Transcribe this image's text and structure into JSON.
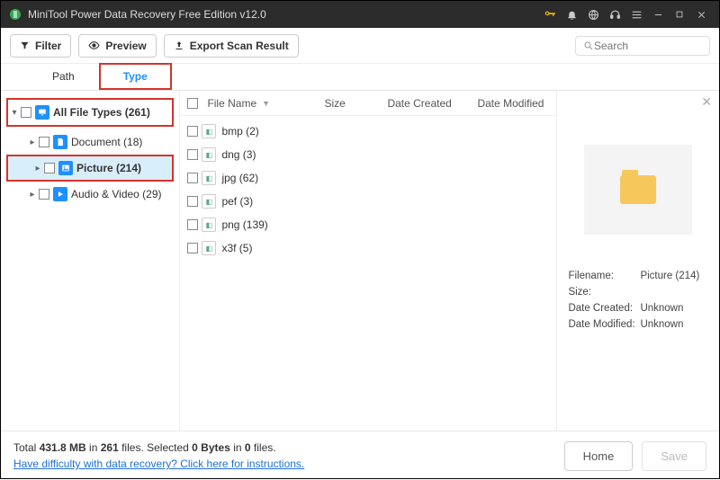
{
  "window": {
    "title": "MiniTool Power Data Recovery Free Edition v12.0"
  },
  "toolbar": {
    "filter": "Filter",
    "preview": "Preview",
    "export": "Export Scan Result",
    "search_placeholder": "Search"
  },
  "tabs": {
    "path": "Path",
    "type": "Type"
  },
  "tree": {
    "root": "All File Types (261)",
    "items": [
      {
        "label": "Document (18)"
      },
      {
        "label": "Picture (214)"
      },
      {
        "label": "Audio & Video (29)"
      }
    ]
  },
  "filelist": {
    "headers": {
      "name": "File Name",
      "size": "Size",
      "created": "Date Created",
      "modified": "Date Modified"
    },
    "rows": [
      {
        "name": "bmp (2)"
      },
      {
        "name": "dng (3)"
      },
      {
        "name": "jpg (62)"
      },
      {
        "name": "pef (3)"
      },
      {
        "name": "png (139)"
      },
      {
        "name": "x3f (5)"
      }
    ]
  },
  "preview": {
    "filename_label": "Filename:",
    "filename_value": "Picture (214)",
    "size_label": "Size:",
    "size_value": "",
    "created_label": "Date Created:",
    "created_value": "Unknown",
    "modified_label": "Date Modified:",
    "modified_value": "Unknown"
  },
  "footer": {
    "total_prefix": "Total ",
    "total_size": "431.8 MB",
    "total_mid": " in ",
    "total_files": "261",
    "total_suffix": " files.",
    "sel_prefix": "   Selected ",
    "sel_bytes": "0 Bytes",
    "sel_mid": " in ",
    "sel_files": "0",
    "sel_suffix": " files.",
    "help_link": "Have difficulty with data recovery? Click here for instructions.",
    "home": "Home",
    "save": "Save"
  }
}
